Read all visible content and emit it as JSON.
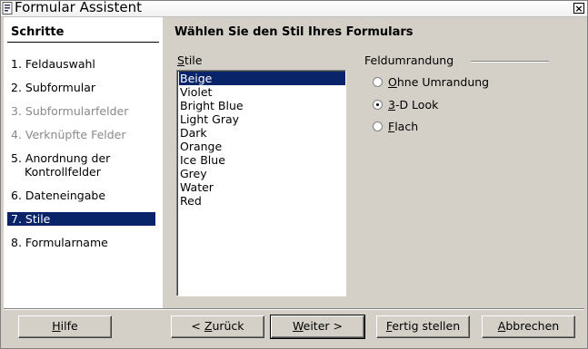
{
  "window": {
    "title": "Formular Assistent",
    "close_label": "×"
  },
  "steps": {
    "header": "Schritte",
    "items": [
      {
        "label": "1. Feldauswahl",
        "state": "normal"
      },
      {
        "label": "2. Subformular",
        "state": "normal"
      },
      {
        "label": "3. Subformularfelder",
        "state": "disabled"
      },
      {
        "label": "4. Verknüpfte Felder",
        "state": "disabled"
      },
      {
        "label": "5. Anordnung der",
        "label2": "Kontrollfelder",
        "state": "normal"
      },
      {
        "label": "6. Dateneingabe",
        "state": "normal"
      },
      {
        "label": "7. Stile",
        "state": "selected"
      },
      {
        "label": "8. Formularname",
        "state": "normal"
      }
    ]
  },
  "main": {
    "title": "Wählen Sie den Stil Ihres Formulars",
    "styles_label_first": "S",
    "styles_label_rest": "tile",
    "styles": [
      "Beige",
      "Violet",
      "Bright Blue",
      "Light Gray",
      "Dark",
      "Orange",
      "Ice Blue",
      "Grey",
      "Water",
      "Red"
    ],
    "selected_style": "Beige",
    "border_group_label": "Feldumrandung",
    "border_options": [
      {
        "pre": "",
        "key": "O",
        "post": "hne Umrandung",
        "checked": false
      },
      {
        "pre": "",
        "key": "3",
        "post": "-D Look",
        "checked": true
      },
      {
        "pre": "",
        "key": "F",
        "post": "lach",
        "checked": false
      }
    ]
  },
  "footer": {
    "help": {
      "key": "H",
      "rest": "ilfe"
    },
    "back": {
      "pre": "< ",
      "key": "Z",
      "rest": "urück"
    },
    "next": {
      "key": "W",
      "rest": "eiter >"
    },
    "finish": {
      "key": "F",
      "rest": "ertig stellen"
    },
    "cancel": {
      "key": "A",
      "rest": "bbrechen"
    }
  },
  "colors": {
    "selection": "#0a246a",
    "dialog_bg": "#d4d0c8"
  }
}
